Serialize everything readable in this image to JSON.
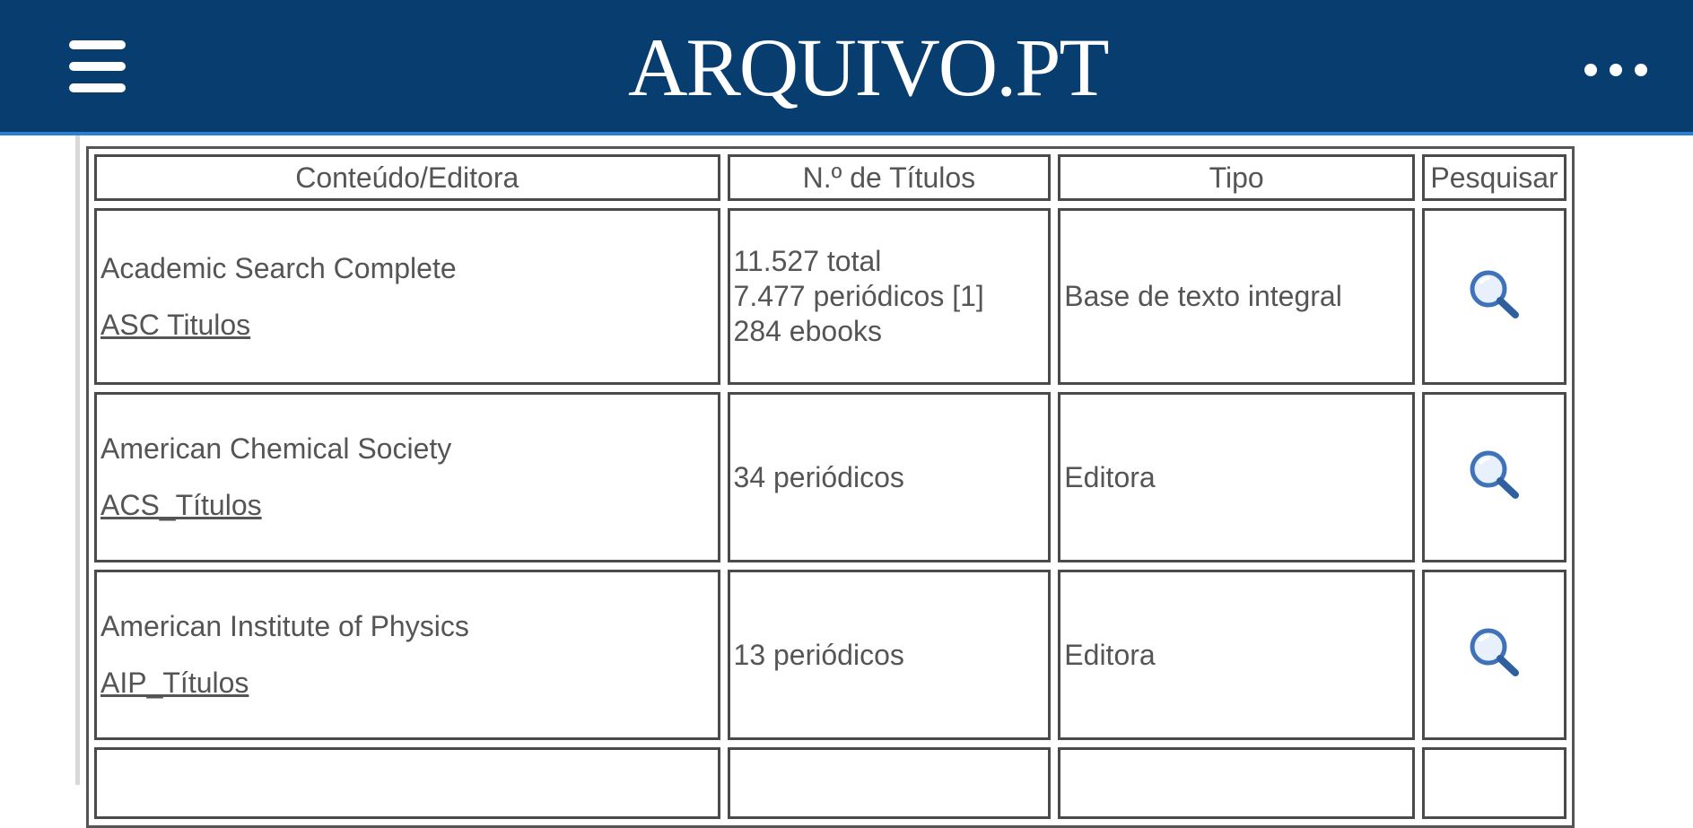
{
  "header": {
    "logo_text": "ARQUIVO.PT",
    "menu_icon": "hamburger-menu-icon",
    "more_icon": "more-horizontal-icon",
    "bg_color": "#073d6f",
    "accent_color": "#2a7fd0"
  },
  "table": {
    "columns": [
      "Conteúdo/Editora",
      "N.º de Títulos",
      "Tipo",
      "Pesquisar"
    ],
    "rows": [
      {
        "name": "Academic Search Complete",
        "link": "ASC Titulos",
        "titles": [
          "11.527 total",
          "7.477 periódicos [1]",
          "284 ebooks"
        ],
        "type": "Base de texto integral",
        "search_icon": "search-icon"
      },
      {
        "name": "American Chemical Society",
        "link": "ACS_Títulos",
        "titles": [
          "34 periódicos"
        ],
        "type": "Editora",
        "search_icon": "search-icon"
      },
      {
        "name": "American Institute of Physics",
        "link": "AIP_Títulos",
        "titles": [
          "13 periódicos"
        ],
        "type": "Editora",
        "search_icon": "search-icon"
      }
    ]
  }
}
